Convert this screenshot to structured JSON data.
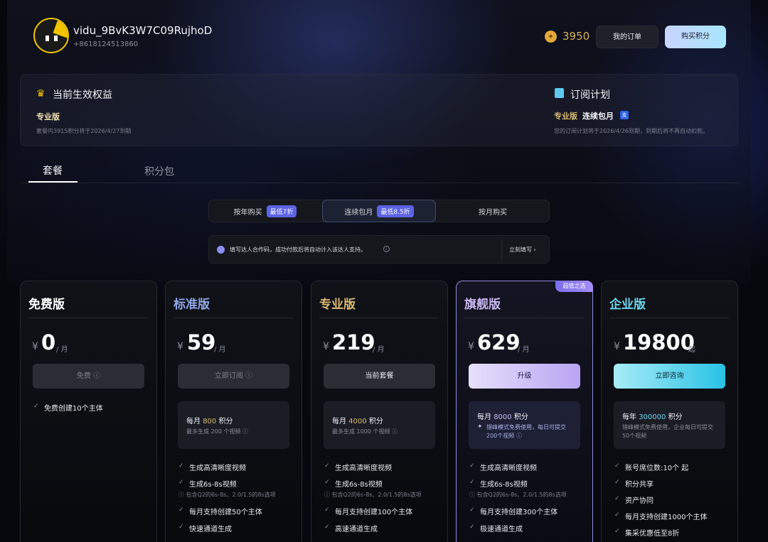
{
  "user": {
    "name": "vidu_9BvK3W7C09RujhoD",
    "phone": "+8618124513860"
  },
  "header": {
    "points": "3950",
    "orders_label": "我的订单",
    "buy_label": "购买积分",
    "coin_icon": "coin-icon"
  },
  "rights": {
    "title": "当前生效权益",
    "plan": "专业版",
    "note": "套餐内3915积分将于2026/4/27到期"
  },
  "subscription": {
    "title": "订阅计划",
    "plan": "专业版",
    "mode": "连续包月",
    "badge": "支",
    "note": "您的订阅计划将于2026/4/26到期，到期后将不再自动扣款。"
  },
  "tabs": [
    {
      "label": "套餐"
    },
    {
      "label": "积分包"
    }
  ],
  "billing": [
    {
      "label": "按年购买",
      "pill": "最低7折"
    },
    {
      "label": "连续包月",
      "pill": "最低8.5折"
    },
    {
      "label": "按月购买",
      "pill": ""
    }
  ],
  "notice": {
    "text": "填写达人合作码，成功付款后将自动计入该达人支持。",
    "link": "立刻填写",
    "info_icon": "i"
  },
  "colors": {
    "accent": "#5c63e6",
    "gold": "#d9b870",
    "standard": "#8fa8e8",
    "flagship": "#c9b8f0",
    "enterprise": "#6ad6ee"
  },
  "plans": [
    {
      "name": "免费版",
      "currency": "¥",
      "price": "0",
      "unit": "/ 月",
      "button": "免费",
      "features": [
        "免费创建10个主体"
      ]
    },
    {
      "name": "标准版",
      "currency": "¥",
      "price": "59",
      "unit": "/ 月",
      "button": "立即订阅",
      "box_title_a": "每月",
      "box_points": "800",
      "box_title_b": "积分",
      "box_sub": "最多生成 200 个视频",
      "features": [
        "生成高清晰度视频",
        "生成6s-8s视频",
        "每月支持创建50个主体",
        "快速通道生成"
      ],
      "feature_note": "包含Q2的6s-8s、2.0/1.5的8s选项"
    },
    {
      "name": "专业版",
      "currency": "¥",
      "price": "219",
      "unit": "/ 月",
      "button": "当前套餐",
      "box_title_a": "每月",
      "box_points": "4000",
      "box_title_b": "积分",
      "box_sub": "最多生成 1000 个视频",
      "features": [
        "生成高清晰度视频",
        "生成6s-8s视频",
        "每月支持创建100个主体",
        "高速通道生成"
      ],
      "feature_note": "包含Q2的6s-8s、2.0/1.5的8s选项"
    },
    {
      "name": "旗舰版",
      "currency": "¥",
      "price": "629",
      "unit": "/ 月",
      "button": "升级",
      "corner": "超值之选",
      "box_title_a": "每月",
      "box_points": "8000",
      "box_title_b": "积分",
      "box_sub": "错峰模式免费使用，每日可提交200个视频",
      "features": [
        "生成高清晰度视频",
        "生成6s-8s视频",
        "每月支持创建300个主体",
        "极速通道生成"
      ],
      "feature_note": "包含Q2的6s-8s、2.0/1.5的8s选项"
    },
    {
      "name": "企业版",
      "currency": "¥",
      "price": "19800",
      "unit": "起",
      "button": "立即咨询",
      "box_title_a": "每年",
      "box_points": "300000",
      "box_title_b": "积分",
      "box_sub": "错峰模式免费使用，企业每日可提交50个视频",
      "features": [
        "账号席位数:10个 起",
        "积分共享",
        "资产协同",
        "每月支持创建1000个主体",
        "集采优惠低至8折"
      ]
    }
  ]
}
